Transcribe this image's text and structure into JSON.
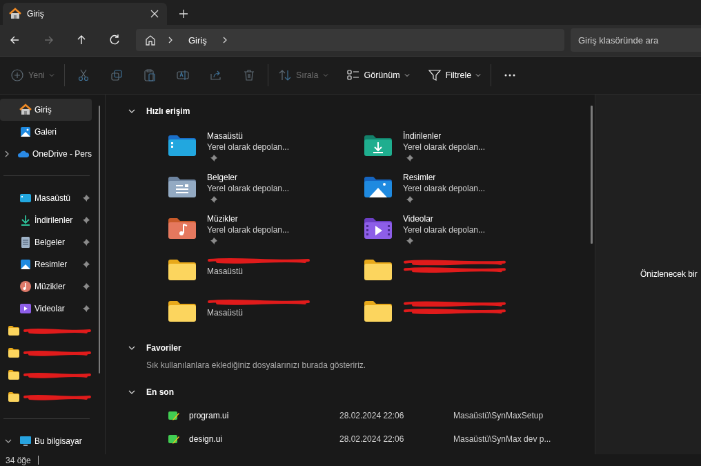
{
  "tabs": [
    {
      "title": "Giriş",
      "selected": true
    }
  ],
  "nav_buttons": [
    {
      "kind": "back",
      "disabled": false
    },
    {
      "kind": "forward",
      "disabled": true
    },
    {
      "kind": "up",
      "disabled": false
    },
    {
      "kind": "refresh",
      "disabled": false
    }
  ],
  "address": {
    "breadcrumbs": [
      "Giriş"
    ]
  },
  "search": {
    "placeholder": "Giriş klasöründe ara"
  },
  "toolbar": {
    "groups": [
      [
        {
          "kind": "new",
          "label": "Yeni",
          "disabled": true
        }
      ],
      [
        {
          "kind": "cut",
          "disabled": true
        },
        {
          "kind": "copy",
          "disabled": true
        },
        {
          "kind": "paste",
          "disabled": true
        },
        {
          "kind": "rename",
          "disabled": true
        },
        {
          "kind": "share",
          "disabled": true
        },
        {
          "kind": "delete",
          "disabled": true
        }
      ],
      [
        {
          "kind": "sort",
          "label": "Sırala",
          "disabled": true
        },
        {
          "kind": "view",
          "label": "Görünüm",
          "disabled": false
        },
        {
          "kind": "filter",
          "label": "Filtrele",
          "disabled": false
        }
      ],
      [
        {
          "kind": "more",
          "disabled": false
        }
      ]
    ]
  },
  "sidebar": {
    "top": [
      {
        "label": "Giriş",
        "kind": "home",
        "selected": true
      },
      {
        "label": "Galeri",
        "kind": "gallery",
        "selected": false
      },
      {
        "label": "OneDrive - Pers",
        "kind": "cloud",
        "selected": false,
        "expanded": false
      }
    ],
    "pinned": [
      {
        "label": "Masaüstü",
        "kind": "desktop",
        "selected": false,
        "pinned": true
      },
      {
        "label": "İndirilenler",
        "kind": "downloads",
        "selected": false,
        "pinned": true
      },
      {
        "label": "Belgeler",
        "kind": "documents",
        "selected": false,
        "pinned": true
      },
      {
        "label": "Resimler",
        "kind": "pictures",
        "selected": false,
        "pinned": true
      },
      {
        "label": "Müzikler",
        "kind": "music",
        "selected": false,
        "pinned": true
      },
      {
        "label": "Videolar",
        "kind": "videos",
        "selected": false,
        "pinned": true
      },
      {
        "kind": "folder",
        "selected": false,
        "redacted": true
      },
      {
        "kind": "folder",
        "selected": false,
        "redacted": true
      },
      {
        "kind": "folder",
        "selected": false,
        "redacted": true
      },
      {
        "kind": "folder",
        "selected": false,
        "redacted": true
      }
    ],
    "bottom": [
      {
        "label": "Bu bilgisayar",
        "kind": "computer",
        "selected": false,
        "expanded": true
      }
    ]
  },
  "quick_access": {
    "title": "Hızlı erişim",
    "expanded": true,
    "items": [
      {
        "name": "Masaüstü",
        "location": "Yerel olarak depolan...",
        "kind": "desktop",
        "pinned": true
      },
      {
        "name": "İndirilenler",
        "location": "Yerel olarak depolan...",
        "kind": "downloads",
        "pinned": true
      },
      {
        "name": "Belgeler",
        "location": "Yerel olarak depolan...",
        "kind": "documents",
        "pinned": true
      },
      {
        "name": "Resimler",
        "location": "Yerel olarak depolan...",
        "kind": "pictures",
        "pinned": true
      },
      {
        "name": "Müzikler",
        "location": "Yerel olarak depolan...",
        "kind": "music",
        "pinned": true
      },
      {
        "name": "Videolar",
        "location": "Yerel olarak depolan...",
        "kind": "videos",
        "pinned": true
      },
      {
        "location": "Masaüstü",
        "kind": "folder",
        "redacted": true
      },
      {
        "kind": "folder",
        "redacted": true
      },
      {
        "location": "Masaüstü",
        "kind": "folder",
        "redacted": true
      },
      {
        "kind": "folder",
        "redacted": true
      }
    ]
  },
  "favorites": {
    "title": "Favoriler",
    "expanded": true,
    "empty_text": "Sık kullanılanlara eklediğiniz dosyalarınızı burada gösteririz."
  },
  "recent": {
    "title": "En son",
    "expanded": true,
    "files": [
      {
        "name": "program.ui",
        "date": "28.02.2024 22:06",
        "location": "Masaüstü\\SynMaxSetup"
      },
      {
        "name": "design.ui",
        "date": "28.02.2024 22:06",
        "location": "Masaüstü\\SynMax dev p..."
      }
    ]
  },
  "preview": {
    "message": "Önizlenecek bir"
  },
  "status_bar": {
    "item_count": "34 öğe"
  }
}
